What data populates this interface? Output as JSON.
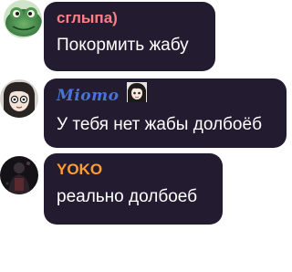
{
  "messages": [
    {
      "author": "сглыпа)",
      "author_color": "#ff7f86",
      "text": "Покормить жабу",
      "avatar_icon": "frog-avatar-icon"
    },
    {
      "author": "Miomo",
      "author_color": "#4a72d8",
      "text": "У тебя нет жабы долбоёб",
      "avatar_icon": "anime-girl-avatar-icon",
      "badge_icon": "anime-face-sticker-icon"
    },
    {
      "author": "YOKO",
      "author_color": "#ff9c33",
      "text": "реально долбоеб",
      "avatar_icon": "dark-figure-avatar-icon"
    }
  ],
  "colors": {
    "bubble": "#231c30",
    "message_text": "#ffffff"
  }
}
